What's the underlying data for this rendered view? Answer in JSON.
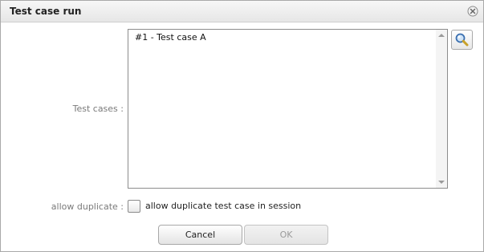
{
  "dialog": {
    "title": "Test case run"
  },
  "form": {
    "test_cases_label": "Test cases :",
    "test_cases_items": [
      "#1 - Test case A"
    ],
    "allow_duplicate_label": "allow duplicate :",
    "allow_duplicate_text": "allow duplicate test case in session",
    "allow_duplicate_checked": false
  },
  "buttons": {
    "cancel_label": "Cancel",
    "ok_label": "OK"
  },
  "icons": {
    "close": "close-icon",
    "search": "magnifier-icon"
  }
}
